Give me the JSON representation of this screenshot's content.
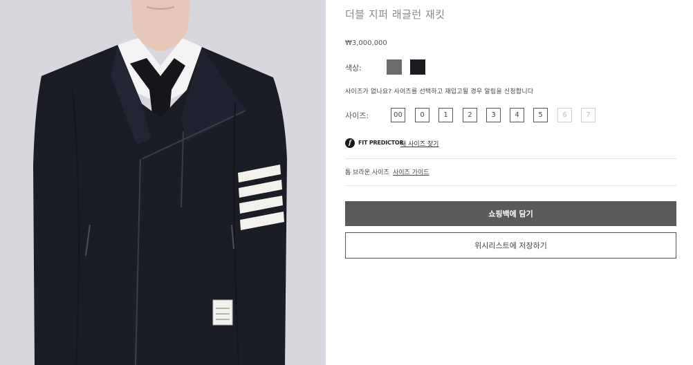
{
  "product": {
    "title": "더블 지퍼 래글런 재킷",
    "price": "₩3,000,000"
  },
  "color": {
    "label": "색상:",
    "swatches": [
      {
        "name": "gray",
        "hex": "#6b6e6c"
      },
      {
        "name": "navy",
        "hex": "#1b1d23"
      }
    ]
  },
  "size_notice": "사이즈가 없나요? 사이즈를 선택하고 재입고될 경우 알림을 신청합니다",
  "size": {
    "label": "사이즈:",
    "options": [
      {
        "label": "00",
        "available": true
      },
      {
        "label": "0",
        "available": true
      },
      {
        "label": "1",
        "available": true
      },
      {
        "label": "2",
        "available": true
      },
      {
        "label": "3",
        "available": true
      },
      {
        "label": "4",
        "available": true
      },
      {
        "label": "5",
        "available": true
      },
      {
        "label": "6",
        "available": false
      },
      {
        "label": "7",
        "available": false
      }
    ]
  },
  "fit_predictor": {
    "logo": "f",
    "brand": "FIT PREDICTOR",
    "link": "내 사이즈 찾기"
  },
  "size_guide": {
    "prefix": "톰 브라운 사이즈",
    "link": "사이즈 가이드"
  },
  "actions": {
    "add_to_bag": "쇼핑백에 담기",
    "save_to_wishlist": "위시리스트에 저장하기"
  },
  "colors": {
    "button_dark": "#5a5a5a",
    "image_background": "#d8d7dd"
  }
}
